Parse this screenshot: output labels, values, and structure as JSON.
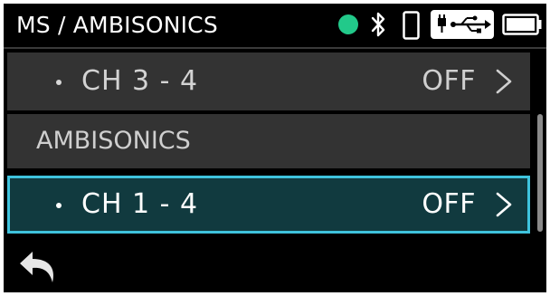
{
  "header": {
    "title": "MS / AMBISONICS",
    "status_color": "#22c98a",
    "icons": [
      "status-dot",
      "bluetooth-icon",
      "phone-icon",
      "usb-power-icon",
      "battery-icon"
    ]
  },
  "list": {
    "items": [
      {
        "type": "item",
        "label": "CH 3 - 4",
        "value": "OFF",
        "selected": false
      },
      {
        "type": "section",
        "label": "AMBISONICS"
      },
      {
        "type": "item",
        "label": "CH 1 - 4",
        "value": "OFF",
        "selected": true
      }
    ]
  },
  "colors": {
    "background": "#000000",
    "row": "#333333",
    "selected_row": "#113a3f",
    "selected_outline": "#3fc3dd"
  },
  "footer": {
    "back_icon": "back-arrow-icon"
  }
}
